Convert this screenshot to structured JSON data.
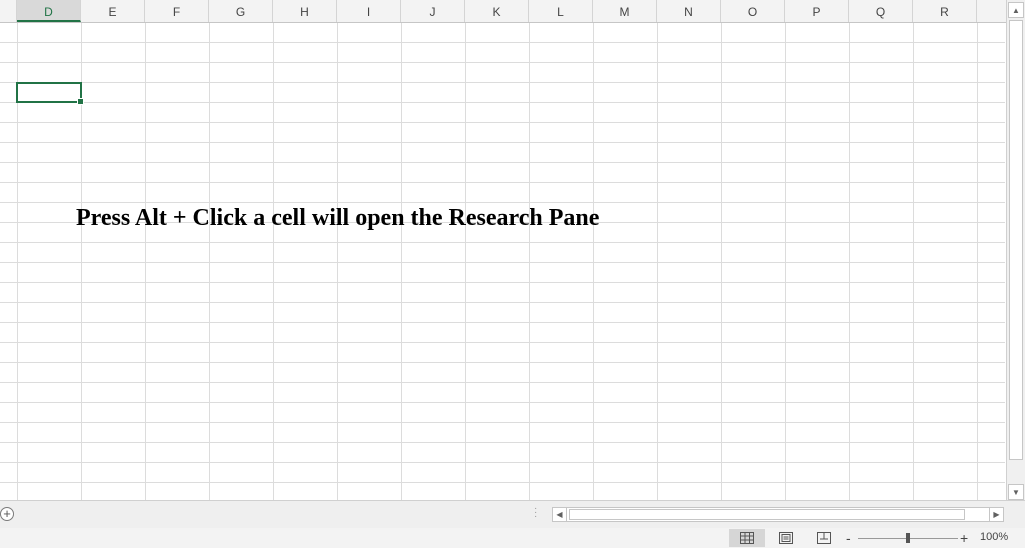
{
  "columns": [
    "D",
    "E",
    "F",
    "G",
    "H",
    "I",
    "J",
    "K",
    "L",
    "M",
    "N",
    "O",
    "P",
    "Q",
    "R"
  ],
  "active_column": "D",
  "overlay_text": "Press Alt + Click a cell will open the Research Pane",
  "zoom": {
    "minus_label": "-",
    "plus_label": "+",
    "level": "100%"
  },
  "icons": {
    "add_sheet": "plus-circle-icon",
    "scroll_up": "triangle-up-icon",
    "scroll_down": "triangle-down-icon",
    "scroll_left": "triangle-left-icon",
    "scroll_right": "triangle-right-icon",
    "normal_view": "grid-view-icon",
    "page_layout": "page-layout-icon",
    "page_break": "page-break-icon"
  },
  "colors": {
    "accent": "#217346",
    "gridline": "#dcdcdc",
    "header_bg": "#f3f3f3"
  }
}
